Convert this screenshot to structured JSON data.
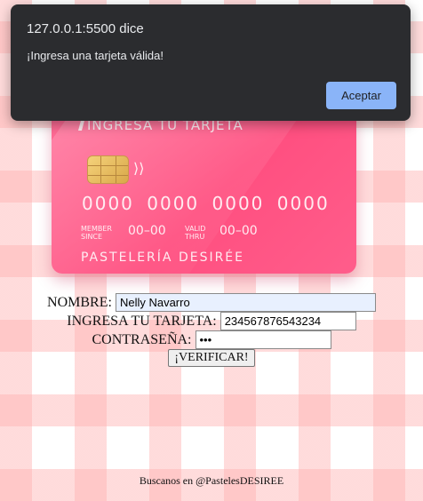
{
  "card": {
    "title": "INGRESA TU TARJETA",
    "number": "0000 0000 0000 0000",
    "member_label_1": "MEMBER",
    "member_label_2": "SINCE",
    "member_value": "00–00",
    "valid_label_1": "VALID",
    "valid_label_2": "THRU",
    "valid_value": "00–00",
    "brand": "PASTELERÍA DESIRÉE",
    "chip_icon": "chip-icon",
    "contactless_icon": "contactless-icon",
    "contactless_glyph": "⟩⟩"
  },
  "form": {
    "name_label": "NOMBRE:",
    "name_value": "Nelly Navarro",
    "card_label": "INGRESA TU TARJETA:",
    "card_value": "234567876543234",
    "password_label": "CONTRASEÑA:",
    "password_value": "123",
    "verify_button": "¡VERIFICAR!"
  },
  "footer": {
    "text": "Buscanos en @PastelesDESIREE"
  },
  "alert": {
    "origin": "127.0.0.1:5500 dice",
    "message": "¡Ingresa una tarjeta válida!",
    "ok_button": "Aceptar"
  },
  "colors": {
    "card_pink": "#ff4f80",
    "alert_bg": "#2b2c2f",
    "alert_button": "#8ab4f8",
    "stripe": "#ffb0b0"
  }
}
